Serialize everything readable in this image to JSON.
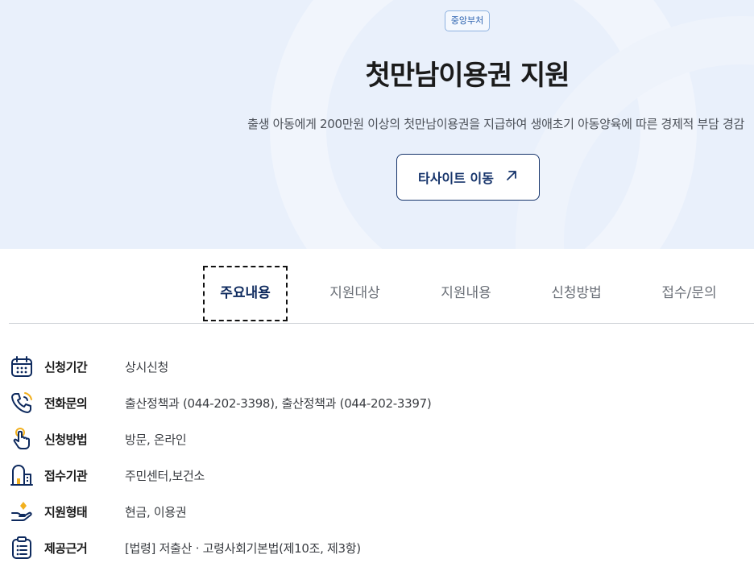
{
  "hero": {
    "badge": "중앙부처",
    "title": "첫만남이용권 지원",
    "subtitle": "출생 아동에게 200만원 이상의 첫만남이용권을 지급하여 생애초기 아동양육에 따른 경제적 부담 경감",
    "site_button_label": "타사이트 이동",
    "colors": {
      "hero_bg": "#e9f0fb",
      "primary": "#16346b",
      "badge_text": "#2c63b0"
    }
  },
  "tabs": [
    {
      "label": "주요내용",
      "active": true
    },
    {
      "label": "지원대상",
      "active": false
    },
    {
      "label": "지원내용",
      "active": false
    },
    {
      "label": "신청방법",
      "active": false
    },
    {
      "label": "접수/문의",
      "active": false
    }
  ],
  "info": [
    {
      "icon": "calendar-icon",
      "label": "신청기간",
      "value": "상시신청"
    },
    {
      "icon": "phone-icon",
      "label": "전화문의",
      "value": "출산정책과 (044-202-3398), 출산정책과 (044-202-3397)"
    },
    {
      "icon": "hand-pointer-icon",
      "label": "신청방법",
      "value": "방문, 온라인"
    },
    {
      "icon": "building-icon",
      "label": "접수기관",
      "value": "주민센터,보건소"
    },
    {
      "icon": "hand-coin-icon",
      "label": "지원형태",
      "value": "현금, 이용권"
    },
    {
      "icon": "clipboard-list-icon",
      "label": "제공근거",
      "value": "[법령] 저출산ㆍ고령사회기본법(제10조, 제3항)"
    }
  ]
}
